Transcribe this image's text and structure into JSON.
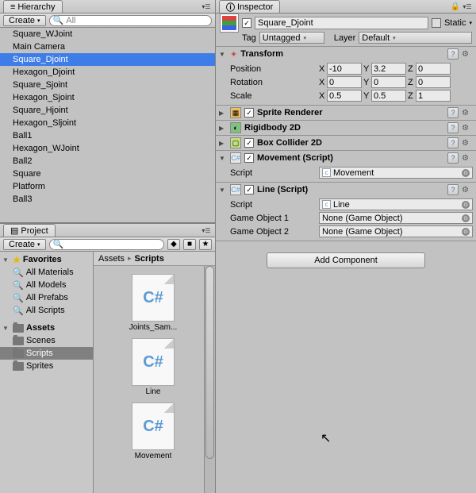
{
  "hierarchy": {
    "title": "Hierarchy",
    "create": "Create",
    "search_placeholder": "All",
    "items": [
      "Square_WJoint",
      "Main Camera",
      "Square_Djoint",
      "Hexagon_Djoint",
      "Square_Sjoint",
      "Hexagon_Sjoint",
      "Square_Hjoint",
      "Hexagon_Sljoint",
      "Ball1",
      "Hexagon_WJoint",
      "Ball2",
      "Square",
      "Platform",
      "Ball3"
    ],
    "selected": "Square_Djoint"
  },
  "project": {
    "title": "Project",
    "create": "Create",
    "favorites": "Favorites",
    "fav_items": [
      "All Materials",
      "All Models",
      "All Prefabs",
      "All Scripts"
    ],
    "assets_label": "Assets",
    "folders": [
      "Scenes",
      "Scripts",
      "Sprites"
    ],
    "selected_folder": "Scripts",
    "breadcrumb": [
      "Assets",
      "Scripts"
    ],
    "files": [
      "Joints_Sam...",
      "Line",
      "Movement"
    ]
  },
  "inspector": {
    "title": "Inspector",
    "static_label": "Static",
    "object_name": "Square_Djoint",
    "tag_label": "Tag",
    "tag_value": "Untagged",
    "layer_label": "Layer",
    "layer_value": "Default",
    "transform": {
      "title": "Transform",
      "position": "Position",
      "rotation": "Rotation",
      "scale": "Scale",
      "pos": {
        "x": "-10",
        "y": "3.2",
        "z": "0"
      },
      "rot": {
        "x": "0",
        "y": "0",
        "z": "0"
      },
      "scl": {
        "x": "0.5",
        "y": "0.5",
        "z": "1"
      }
    },
    "comp_sprite": "Sprite Renderer",
    "comp_rb": "Rigidbody 2D",
    "comp_box": "Box Collider 2D",
    "movement": {
      "title": "Movement (Script)",
      "script_label": "Script",
      "script_value": "Movement"
    },
    "line": {
      "title": "Line (Script)",
      "script_label": "Script",
      "script_value": "Line",
      "go1_label": "Game Object 1",
      "go1_value": "None (Game Object)",
      "go2_label": "Game Object 2",
      "go2_value": "None (Game Object)"
    },
    "add_component": "Add Component"
  }
}
